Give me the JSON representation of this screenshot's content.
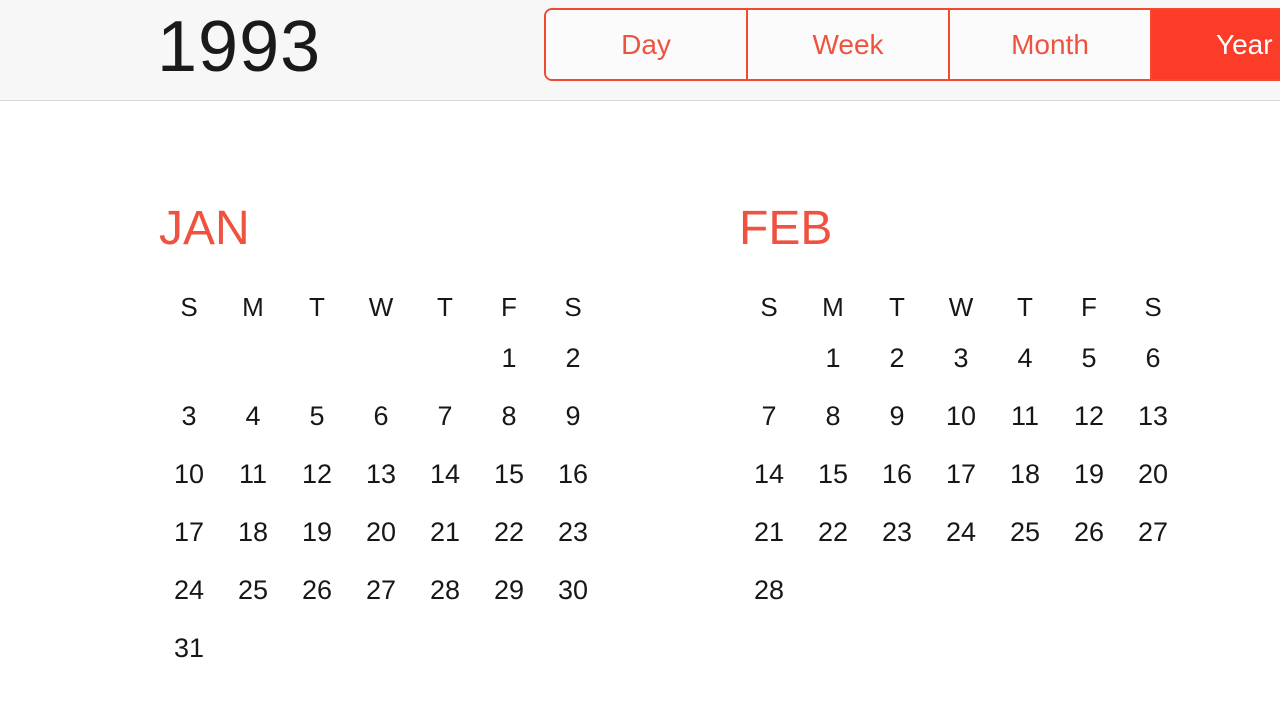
{
  "header": {
    "year": "1993",
    "segments": [
      {
        "label": "Day",
        "selected": false
      },
      {
        "label": "Week",
        "selected": false
      },
      {
        "label": "Month",
        "selected": false
      },
      {
        "label": "Year",
        "selected": true
      }
    ]
  },
  "colors": {
    "accent_selected_bg": "#FA3C28",
    "accent_text": "#EF5340",
    "accent_border": "#F04A32",
    "header_bg": "#F7F7F7",
    "header_border": "#D8D8D8",
    "day_text": "#17171A",
    "year_text": "#1A1A1A",
    "page_bg": "#FFFFFF"
  },
  "calendar": {
    "weekday_headers": [
      "S",
      "M",
      "T",
      "W",
      "T",
      "F",
      "S"
    ],
    "months": [
      {
        "name": "JAN",
        "weeks": [
          [
            "",
            "",
            "",
            "",
            "",
            "1",
            "2"
          ],
          [
            "3",
            "4",
            "5",
            "6",
            "7",
            "8",
            "9"
          ],
          [
            "10",
            "11",
            "12",
            "13",
            "14",
            "15",
            "16"
          ],
          [
            "17",
            "18",
            "19",
            "20",
            "21",
            "22",
            "23"
          ],
          [
            "24",
            "25",
            "26",
            "27",
            "28",
            "29",
            "30"
          ],
          [
            "31",
            "",
            "",
            "",
            "",
            "",
            ""
          ]
        ]
      },
      {
        "name": "FEB",
        "weeks": [
          [
            "",
            "1",
            "2",
            "3",
            "4",
            "5",
            "6"
          ],
          [
            "7",
            "8",
            "9",
            "10",
            "11",
            "12",
            "13"
          ],
          [
            "14",
            "15",
            "16",
            "17",
            "18",
            "19",
            "20"
          ],
          [
            "21",
            "22",
            "23",
            "24",
            "25",
            "26",
            "27"
          ],
          [
            "28",
            "",
            "",
            "",
            "",
            "",
            ""
          ]
        ]
      }
    ]
  }
}
